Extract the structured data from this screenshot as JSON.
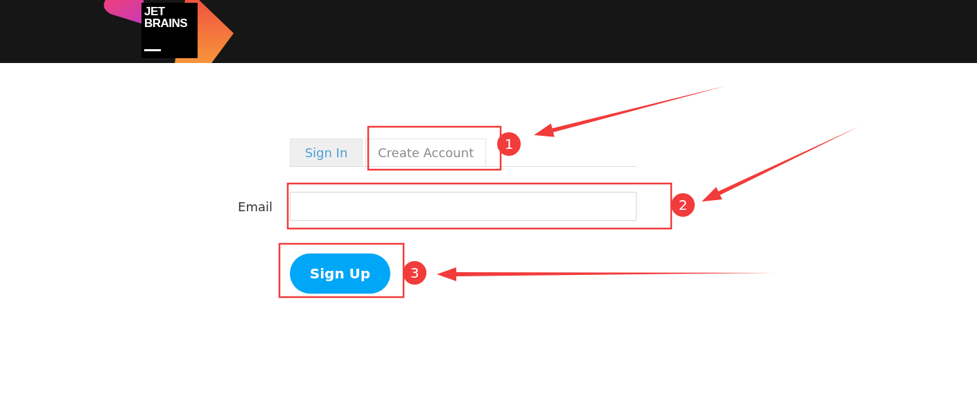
{
  "header": {
    "logo": {
      "lines": [
        "JET",
        "BRAINS"
      ]
    }
  },
  "tabs": [
    {
      "label": "Sign In",
      "selected": false
    },
    {
      "label": "Create Account",
      "selected": true
    }
  ],
  "form": {
    "email_label": "Email",
    "button": "Sign Up"
  },
  "annotations": [
    {
      "label": "1"
    },
    {
      "label": "2"
    },
    {
      "label": "3"
    }
  ]
}
